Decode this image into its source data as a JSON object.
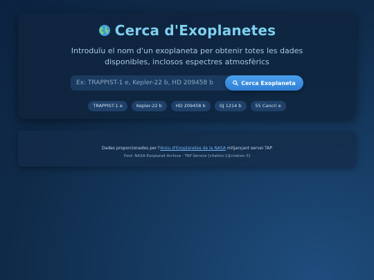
{
  "header": {
    "title": "Cerca d'Exoplanetes",
    "subtitle": "Introduïu el nom d'un exoplaneta per obtenir totes les dades disponibles, inclosos espectres atmosfèrics"
  },
  "search": {
    "placeholder": "Ex: TRAPPIST-1 e, Kepler-22 b, HD 209458 b",
    "button_label": "Cerca Exoplaneta"
  },
  "examples": [
    "TRAPPIST-1 e",
    "Kepler-22 b",
    "HD 209458 b",
    "GJ 1214 b",
    "55 Cancri e"
  ],
  "footer": {
    "credit_prefix": "Dades proporcionades per l'",
    "credit_link": "Arxiu d'Exoplanetes de la NASA",
    "credit_suffix": " mitjançant servei TAP",
    "source": "Font: NASA Exoplanet Archive - TAP Service [citation:1][citation:3]"
  },
  "colors": {
    "accent": "#3a8fe0",
    "title": "#7fd0f0",
    "chip_bg": "#1f4068"
  },
  "icons": {
    "title_icon": "globe-icon",
    "button_icon": "search-icon"
  }
}
